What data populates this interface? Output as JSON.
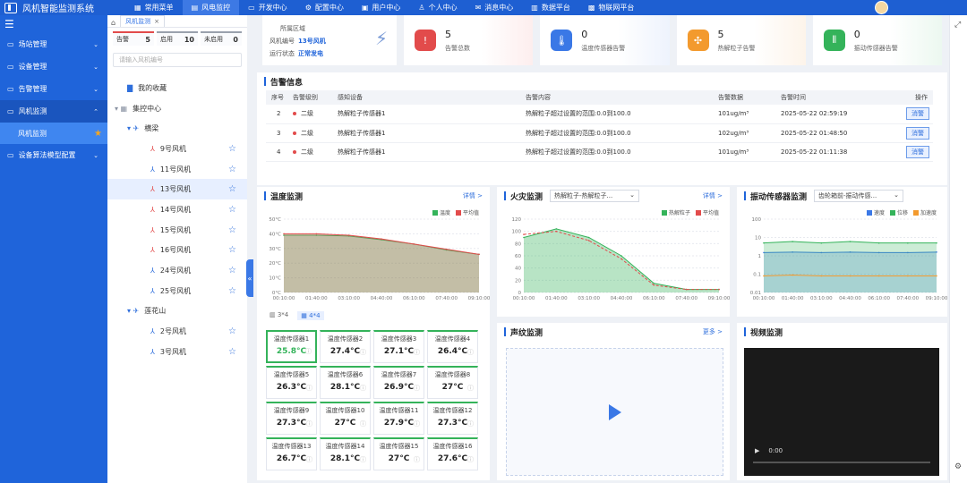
{
  "app": {
    "title": "风机智能监测系统"
  },
  "topnav": [
    {
      "label": "常用菜单",
      "icon": "grid-icon"
    },
    {
      "label": "风电监控",
      "icon": "document-icon",
      "active": true
    },
    {
      "label": "开发中心",
      "icon": "folder-icon"
    },
    {
      "label": "配置中心",
      "icon": "gear-icon"
    },
    {
      "label": "用户中心",
      "icon": "card-icon"
    },
    {
      "label": "个人中心",
      "icon": "user-icon"
    },
    {
      "label": "消息中心",
      "icon": "bell-icon"
    },
    {
      "label": "数据平台",
      "icon": "chart-icon"
    },
    {
      "label": "物联网平台",
      "icon": "chip-icon"
    }
  ],
  "sidebar": {
    "items": [
      {
        "label": "场站管理",
        "icon": "monitor-icon"
      },
      {
        "label": "设备管理",
        "icon": "monitor-icon"
      },
      {
        "label": "告警管理",
        "icon": "monitor-icon"
      },
      {
        "label": "风机监测",
        "icon": "monitor-icon",
        "open": true
      },
      {
        "label": "设备算法模型配置",
        "icon": "monitor-icon"
      }
    ],
    "sub": {
      "label": "风机监测"
    }
  },
  "treepanel": {
    "tab": "风机监测",
    "stats": [
      {
        "label": "告警",
        "value": "5"
      },
      {
        "label": "启用",
        "value": "10"
      },
      {
        "label": "未启用",
        "value": "0"
      }
    ],
    "search_placeholder": "请输入风机编号",
    "favorites": "我的收藏",
    "root": "集控中心",
    "groups": [
      {
        "name": "横梁",
        "turbines": [
          {
            "name": "9号风机",
            "color": "#e24b4b"
          },
          {
            "name": "11号风机",
            "color": "#2f6fdc"
          },
          {
            "name": "13号风机",
            "color": "#e24b4b",
            "selected": true
          },
          {
            "name": "14号风机",
            "color": "#e24b4b"
          },
          {
            "name": "15号风机",
            "color": "#e24b4b"
          },
          {
            "name": "16号风机",
            "color": "#e24b4b"
          },
          {
            "name": "24号风机",
            "color": "#2f6fdc"
          },
          {
            "name": "25号风机",
            "color": "#2f6fdc"
          }
        ]
      },
      {
        "name": "莲花山",
        "turbines": [
          {
            "name": "2号风机",
            "color": "#2f6fdc"
          },
          {
            "name": "3号风机",
            "color": "#2f6fdc"
          }
        ]
      }
    ]
  },
  "region": {
    "label": "所属区域",
    "id_label": "风机编号",
    "id_value": "13号风机",
    "status_label": "运行状态",
    "status_value": "正常发电"
  },
  "cards": [
    {
      "value": "5",
      "label": "告警总数",
      "color": "#e24b4b",
      "bg": "#fdeeee",
      "icon": "alert-icon",
      "glyph": "!"
    },
    {
      "value": "0",
      "label": "温度传感器告警",
      "color": "#3a78e6",
      "bg": "#eef3fd",
      "icon": "thermometer-icon",
      "glyph": "🌡"
    },
    {
      "value": "5",
      "label": "热解粒子告警",
      "color": "#f39a2e",
      "bg": "#fdf4ea",
      "icon": "fan-icon",
      "glyph": "✣"
    },
    {
      "value": "0",
      "label": "振动传感器告警",
      "color": "#34b35a",
      "bg": "#ecf8f0",
      "icon": "vibration-icon",
      "glyph": "⦀"
    }
  ],
  "alarms": {
    "title": "告警信息",
    "headers": [
      "序号",
      "告警级别",
      "感知设备",
      "告警内容",
      "告警数据",
      "告警时间",
      "操作"
    ],
    "rows": [
      {
        "no": "2",
        "level": "二级",
        "device": "热解粒子传感器1",
        "content": "热解粒子超过设置的范围:0.0到100.0",
        "data": "101ug/m³",
        "time": "2025-05-22 02:59:19",
        "action": "消警"
      },
      {
        "no": "3",
        "level": "二级",
        "device": "热解粒子传感器1",
        "content": "热解粒子超过设置的范围:0.0到100.0",
        "data": "102ug/m³",
        "time": "2025-05-22 01:48:50",
        "action": "消警"
      },
      {
        "no": "4",
        "level": "二级",
        "device": "热解粒子传感器1",
        "content": "热解粒子超过设置的范围:0.0到100.0",
        "data": "101ug/m³",
        "time": "2025-05-22 01:11:38",
        "action": "消警"
      }
    ]
  },
  "temp_panel": {
    "title": "温度监测",
    "more": "详情 >",
    "layout_options": [
      "3*4",
      "4*4"
    ]
  },
  "fire_panel": {
    "title": "火灾监测",
    "select": "热解粒子-热解粒子...",
    "more": "详情 >"
  },
  "vib_panel": {
    "title": "振动传感器监测",
    "select": "齿轮箱前-振动传感..."
  },
  "sound_panel": {
    "title": "声纹监测",
    "more": "更多 >"
  },
  "video_panel": {
    "title": "视频监测",
    "time": "0:00"
  },
  "sensors": [
    {
      "name": "温度传感器1",
      "value": "25.8°C"
    },
    {
      "name": "温度传感器2",
      "value": "27.4°C"
    },
    {
      "name": "温度传感器3",
      "value": "27.1°C"
    },
    {
      "name": "温度传感器4",
      "value": "26.4°C"
    },
    {
      "name": "温度传感器5",
      "value": "26.3°C"
    },
    {
      "name": "温度传感器6",
      "value": "28.1°C"
    },
    {
      "name": "温度传感器7",
      "value": "26.9°C"
    },
    {
      "name": "温度传感器8",
      "value": "27°C"
    },
    {
      "name": "温度传感器9",
      "value": "27.3°C"
    },
    {
      "name": "温度传感器10",
      "value": "27°C"
    },
    {
      "name": "温度传感器11",
      "value": "27.9°C"
    },
    {
      "name": "温度传感器12",
      "value": "27.3°C"
    },
    {
      "name": "温度传感器13",
      "value": "26.7°C"
    },
    {
      "name": "温度传感器14",
      "value": "28.1°C"
    },
    {
      "name": "温度传感器15",
      "value": "27°C"
    },
    {
      "name": "温度传感器16",
      "value": "27.6°C"
    }
  ],
  "chart_data": [
    {
      "type": "area",
      "title": "温度监测",
      "x": [
        "00:10:00",
        "01:40:00",
        "03:10:00",
        "04:40:00",
        "06:10:00",
        "07:40:00",
        "09:10:00"
      ],
      "ylim": [
        0,
        50
      ],
      "yticks": [
        "0°C",
        "10°C",
        "20°C",
        "30°C",
        "40°C",
        "50°C"
      ],
      "series": [
        {
          "name": "温度",
          "color": "#34b35a",
          "values": [
            39,
            39,
            38.5,
            36,
            33,
            29,
            26
          ]
        },
        {
          "name": "平均值",
          "color": "#e24b4b",
          "values": [
            40,
            40,
            39,
            36.5,
            33,
            29.5,
            26
          ]
        }
      ]
    },
    {
      "type": "line",
      "title": "火灾监测",
      "x": [
        "00:10:00",
        "01:40:00",
        "03:10:00",
        "04:40:00",
        "06:10:00",
        "07:40:00",
        "09:10:00"
      ],
      "ylim": [
        0,
        120
      ],
      "yticks": [
        "0",
        "20",
        "40",
        "60",
        "80",
        "100",
        "120"
      ],
      "series": [
        {
          "name": "热解粒子",
          "color": "#34b35a",
          "values": [
            90,
            104,
            90,
            60,
            15,
            5,
            5
          ]
        },
        {
          "name": "平均值",
          "color": "#e24b4b",
          "values": [
            95,
            100,
            85,
            55,
            12,
            5,
            5
          ]
        }
      ]
    },
    {
      "type": "line",
      "title": "振动传感器监测",
      "yscale": "log",
      "x": [
        "00:10:00",
        "01:40:00",
        "03:10:00",
        "04:40:00",
        "06:10:00",
        "07:40:00",
        "09:10:00"
      ],
      "ylim": [
        0.01,
        100
      ],
      "yticks": [
        "0.01",
        "0.1",
        "1",
        "10",
        "100"
      ],
      "series": [
        {
          "name": "速度",
          "color": "#3a78e6",
          "values": [
            1.5,
            1.6,
            1.5,
            1.6,
            1.5,
            1.5,
            1.6
          ]
        },
        {
          "name": "位移",
          "color": "#34b35a",
          "values": [
            5,
            6,
            5,
            6,
            5,
            5,
            5
          ]
        },
        {
          "name": "加速度",
          "color": "#f39a2e",
          "values": [
            0.08,
            0.09,
            0.08,
            0.08,
            0.08,
            0.08,
            0.08
          ]
        }
      ]
    }
  ]
}
